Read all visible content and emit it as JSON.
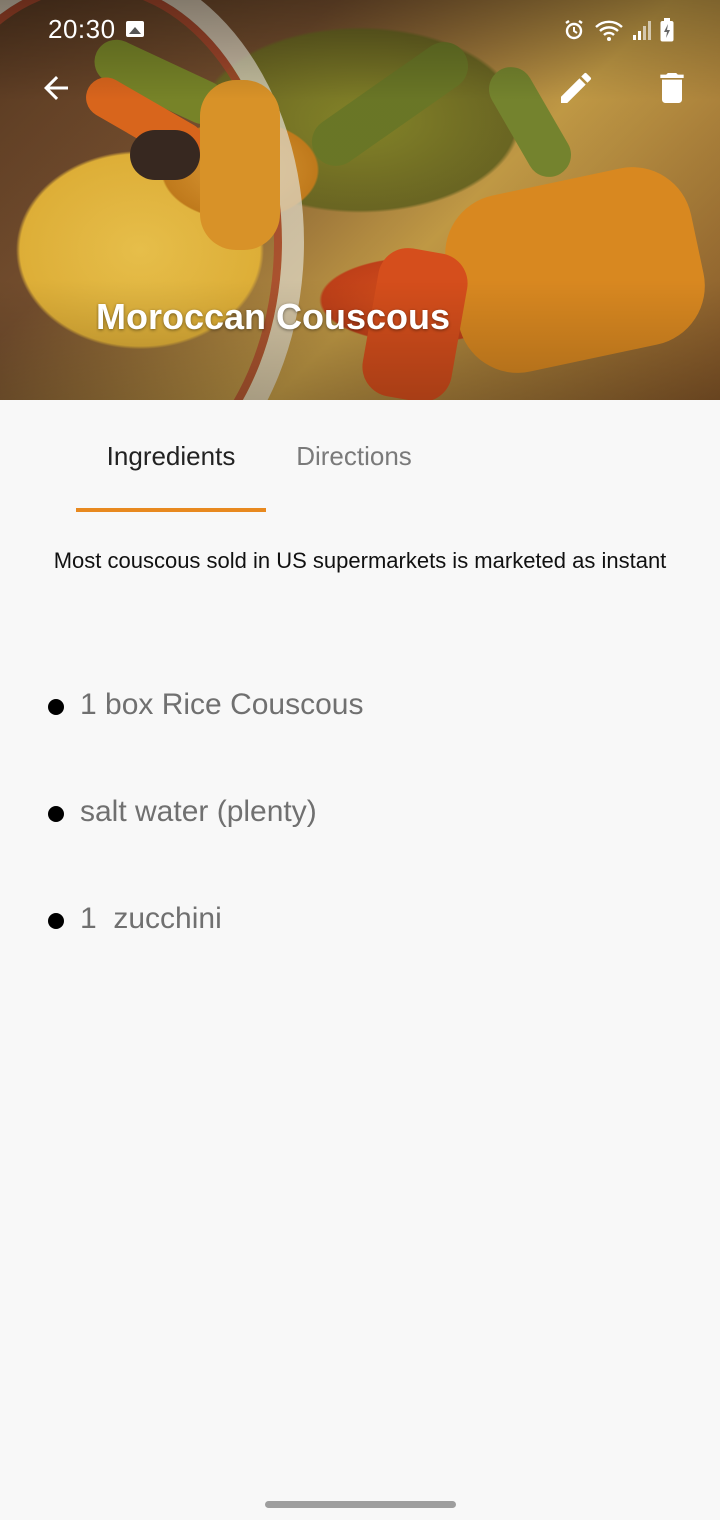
{
  "status_bar": {
    "time": "20:30"
  },
  "hero": {
    "title": "Moroccan Couscous",
    "image_subject": "couscous-with-vegetables"
  },
  "toolbar": {
    "back_icon": "arrow-left-icon",
    "edit_icon": "pencil-icon",
    "delete_icon": "trash-icon"
  },
  "tabs": [
    {
      "label": "Ingredients",
      "selected": true
    },
    {
      "label": "Directions",
      "selected": false
    }
  ],
  "description": "Most couscous sold in US supermarkets is marketed as instant",
  "ingredients": [
    "1 box Rice Couscous",
    "salt water (plenty)",
    "1  zucchini"
  ],
  "colors": {
    "accent": "#e8891f",
    "background": "#f8f8f8",
    "tab_selected": "#222222",
    "tab_unselected": "#7a7a7a",
    "ingredient_text": "#707070"
  }
}
